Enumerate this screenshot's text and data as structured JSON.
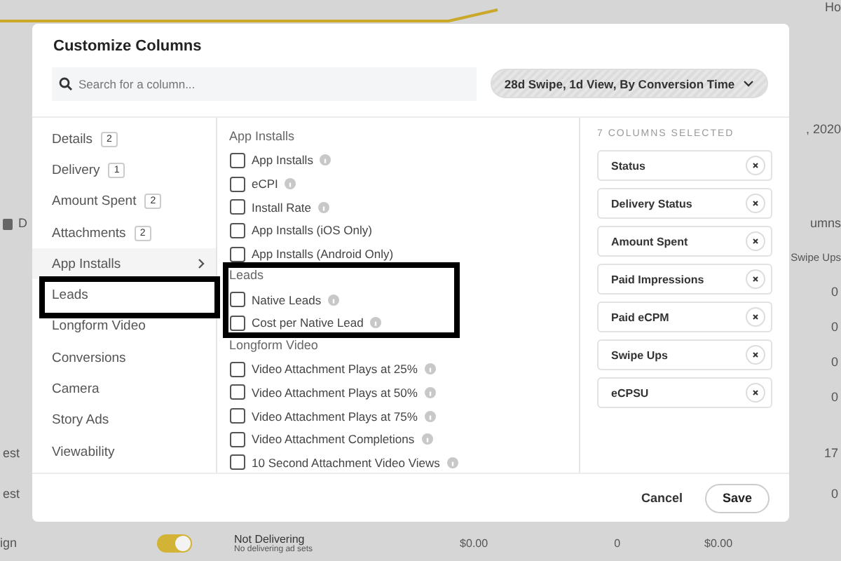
{
  "background": {
    "top_right": "Ho",
    "date_text": ", 2020",
    "column_header": "D",
    "columns_button": "umns",
    "swipe_ups_header": "Swipe Ups",
    "right_values": [
      "0",
      "0",
      "0",
      "0"
    ],
    "rows": [
      {
        "name": "est",
        "value": "17"
      },
      {
        "name": "est",
        "value": "0"
      }
    ],
    "campaign_row": {
      "name": "ign",
      "on": true,
      "status": "Not Delivering",
      "status_detail": "No delivering ad sets",
      "spend": "$0.00",
      "count": "0",
      "cost": "$0.00"
    }
  },
  "modal": {
    "title": "Customize Columns",
    "search": {
      "placeholder": "Search for a column..."
    },
    "attribution": "28d Swipe, 1d View, By Conversion Time",
    "categories": [
      {
        "label": "Details",
        "count": "2",
        "selected": false
      },
      {
        "label": "Delivery",
        "count": "1",
        "selected": false
      },
      {
        "label": "Amount Spent",
        "count": "2",
        "selected": false
      },
      {
        "label": "Attachments",
        "count": "2",
        "selected": false
      },
      {
        "label": "App Installs",
        "selected": true
      },
      {
        "label": "Leads",
        "selected": false
      },
      {
        "label": "Longform Video",
        "selected": false
      },
      {
        "label": "Conversions",
        "selected": false
      },
      {
        "label": "Camera",
        "selected": false
      },
      {
        "label": "Story Ads",
        "selected": false
      },
      {
        "label": "Viewability",
        "selected": false
      }
    ],
    "sections": [
      {
        "title": "App Installs",
        "items": [
          {
            "label": "App Installs",
            "checked": false,
            "info": true
          },
          {
            "label": "eCPI",
            "checked": false,
            "info": true
          },
          {
            "label": "Install Rate",
            "checked": false,
            "info": true
          },
          {
            "label": "App Installs (iOS Only)",
            "checked": false,
            "info": false
          },
          {
            "label": "App Installs (Android Only)",
            "checked": false,
            "info": false
          }
        ]
      },
      {
        "title": "Leads",
        "items": [
          {
            "label": "Native Leads",
            "checked": false,
            "info": true
          },
          {
            "label": "Cost per Native Lead",
            "checked": false,
            "info": true
          }
        ]
      },
      {
        "title": "Longform Video",
        "items": [
          {
            "label": "Video Attachment Plays at 25%",
            "checked": false,
            "info": true
          },
          {
            "label": "Video Attachment Plays at 50%",
            "checked": false,
            "info": true
          },
          {
            "label": "Video Attachment Plays at 75%",
            "checked": false,
            "info": true
          },
          {
            "label": "Video Attachment Completions",
            "checked": false,
            "info": true
          },
          {
            "label": "10 Second Attachment Video Views",
            "checked": false,
            "info": true
          }
        ]
      }
    ],
    "selected_heading": "7 COLUMNS SELECTED",
    "selected_columns": [
      "Status",
      "Delivery Status",
      "Amount Spent",
      "Paid Impressions",
      "Paid eCPM",
      "Swipe Ups",
      "eCPSU"
    ],
    "buttons": {
      "cancel": "Cancel",
      "save": "Save"
    }
  }
}
